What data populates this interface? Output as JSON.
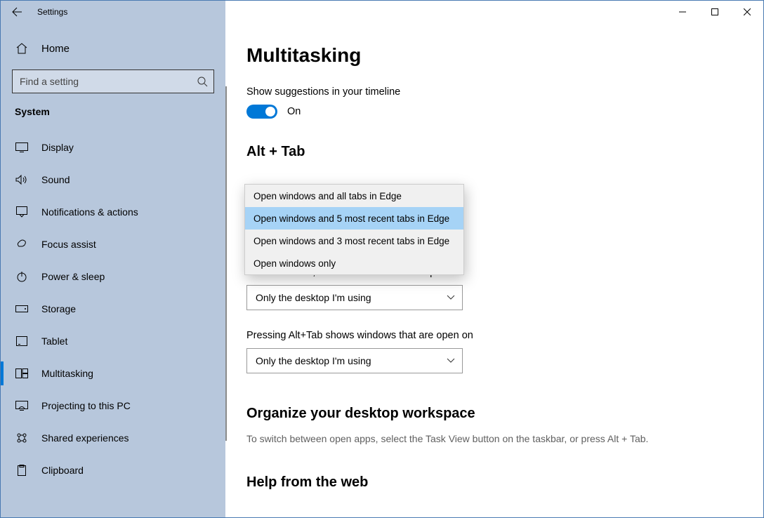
{
  "window": {
    "title": "Settings"
  },
  "sidebar": {
    "home_label": "Home",
    "search_placeholder": "Find a setting",
    "category": "System",
    "items": [
      {
        "id": "display",
        "label": "Display",
        "active": false
      },
      {
        "id": "sound",
        "label": "Sound",
        "active": false
      },
      {
        "id": "notifications",
        "label": "Notifications & actions",
        "active": false
      },
      {
        "id": "focus-assist",
        "label": "Focus assist",
        "active": false
      },
      {
        "id": "power-sleep",
        "label": "Power & sleep",
        "active": false
      },
      {
        "id": "storage",
        "label": "Storage",
        "active": false
      },
      {
        "id": "tablet",
        "label": "Tablet",
        "active": false
      },
      {
        "id": "multitasking",
        "label": "Multitasking",
        "active": true
      },
      {
        "id": "projecting",
        "label": "Projecting to this PC",
        "active": false
      },
      {
        "id": "shared-experiences",
        "label": "Shared experiences",
        "active": false
      },
      {
        "id": "clipboard",
        "label": "Clipboard",
        "active": false
      }
    ]
  },
  "main": {
    "page_title": "Multitasking",
    "timeline_label": "Show suggestions in your timeline",
    "toggle_state": "On",
    "alt_tab_heading": "Alt + Tab",
    "alt_tab_options": [
      "Open windows and all tabs in Edge",
      "Open windows and 5 most recent tabs in Edge",
      "Open windows and 3 most recent tabs in Edge",
      "Open windows only"
    ],
    "alt_tab_selected_index": 1,
    "taskbar_label": "On the taskbar, show windows that are open on",
    "taskbar_value": "Only the desktop I'm using",
    "alttab_label": "Pressing Alt+Tab shows windows that are open on",
    "alttab_value": "Only the desktop I'm using",
    "organize_heading": "Organize your desktop workspace",
    "organize_help": "To switch between open apps, select the Task View button on the taskbar, or press Alt + Tab.",
    "help_heading": "Help from the web"
  }
}
